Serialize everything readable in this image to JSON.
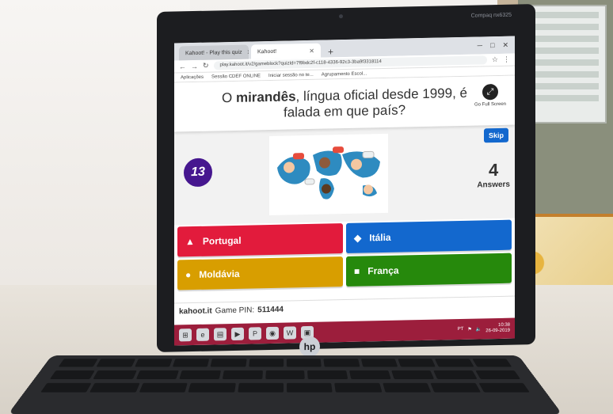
{
  "browser": {
    "tabs": [
      {
        "label": "Kahoot! - Play this quiz"
      },
      {
        "label": "Kahoot!"
      }
    ],
    "new_tab_icon": "plus-icon",
    "url": "play.kahoot.it/v2/gameblock?quizId=7f9bdc2f-c118-4336-92c3-3ba9f3318114",
    "bookmarks": [
      "Aplicações",
      "Sessão CDEF ONLINE",
      "Iniciar sessão no te...",
      "Agrupamento Escol..."
    ]
  },
  "kahoot": {
    "question_pre": "O ",
    "question_bold": "mirandês",
    "question_post": ", língua oficial desde 1999, é falada em que país?",
    "fullscreen_label": "Go Full Screen",
    "skip_label": "Skip",
    "timer": "13",
    "answers_count": "4",
    "answers_label": "Answers",
    "answers": [
      {
        "shape": "▲",
        "label": "Portugal",
        "color": "#e21b3c"
      },
      {
        "shape": "◆",
        "label": "Itália",
        "color": "#1368ce"
      },
      {
        "shape": "●",
        "label": "Moldávia",
        "color": "#d89e00"
      },
      {
        "shape": "■",
        "label": "França",
        "color": "#26890c"
      }
    ],
    "game_pin_prefix": "kahoot.it",
    "game_pin_label": "Game PIN:",
    "game_pin": "511444"
  },
  "taskbar": {
    "language": "PT",
    "time": "10:38",
    "date": "26-09-2019"
  },
  "laptop": {
    "logo": "hp",
    "lid_label": "Compaq nx6325"
  }
}
